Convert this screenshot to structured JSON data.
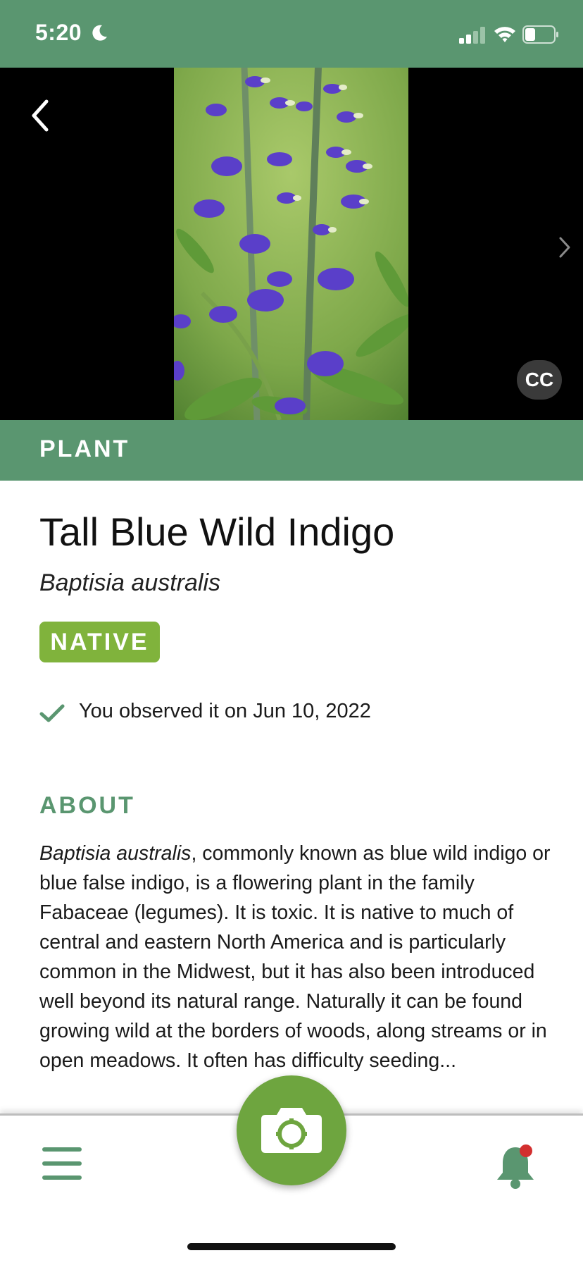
{
  "status": {
    "time": "5:20",
    "icons": [
      "moon-icon",
      "signal-icon",
      "wifi-icon",
      "battery-icon"
    ]
  },
  "header": {
    "back_icon": "chevron-left-icon",
    "next_icon": "chevron-right-icon",
    "cc_label": "CC"
  },
  "category": {
    "label": "PLANT"
  },
  "species": {
    "common_name": "Tall Blue Wild Indigo",
    "scientific_name": "Baptisia australis",
    "badge": "NATIVE",
    "observed": "You observed it on Jun 10, 2022"
  },
  "about": {
    "heading": "ABOUT",
    "lead": "Baptisia australis",
    "body": ", commonly known as blue wild indigo or blue false indigo, is a flowering plant in the family Fabaceae (legumes). It is toxic. It is native to much of central and eastern North America and is particularly common in the Midwest, but it has also been introduced well beyond its natural range. Naturally it can be found growing wild at the borders of woods, along streams or in open meadows. It often has difficulty seeding..."
  },
  "bottom_nav": {
    "menu_icon": "hamburger-menu-icon",
    "camera_icon": "camera-icon",
    "bell_icon": "bell-icon"
  },
  "colors": {
    "brand_green": "#5a9670",
    "native_badge": "#80b33c",
    "camera_button": "#6ea53f",
    "notification_dot": "#d32f2f"
  }
}
